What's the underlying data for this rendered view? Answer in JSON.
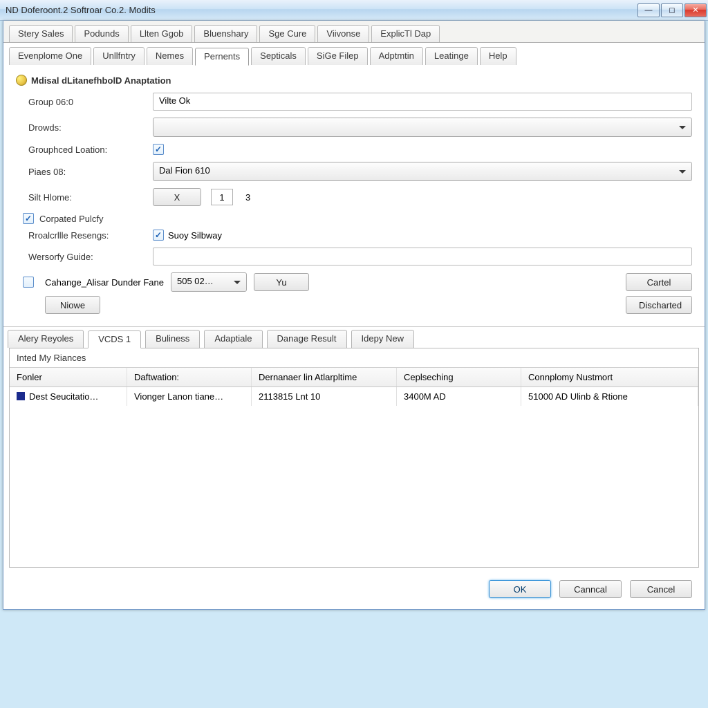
{
  "titlebar": {
    "title": "ND Doferoont.2 Softroar Co.2. Modits"
  },
  "tabs_top": [
    "Stery Sales",
    "Podunds",
    "Llten Ggob",
    "Bluenshary",
    "Sge Cure",
    "Viivonse",
    "ExplicTl Dap"
  ],
  "tabs_main": [
    "Evenplome One",
    "Unllfntry",
    "Nemes",
    "Pernents",
    "Septicals",
    "SiGe Filep",
    "Adptmtin",
    "Leatinge",
    "Help"
  ],
  "tabs_main_active": 3,
  "section": {
    "title": "Mdisal dLitanefhbolD Anaptation",
    "group_label": "Group 06:0",
    "group_value": "Vilte Ok",
    "drowds_label": "Drowds:",
    "drowds_value": "",
    "grouphced_label": "Grouphced Loation:",
    "grouphced_checked": true,
    "piaes_label": "Piaes 08:",
    "piaes_value": "Dal Fion 610",
    "silhome_label": "Silt Hlome:",
    "silhome_x": "X",
    "silhome_1": "1",
    "silhome_3": "3"
  },
  "corpated": {
    "checked": true,
    "label": "Corpated Pulcfy",
    "rroalcr_label": "Rroalcrllle Resengs:",
    "suoy_checked": true,
    "suoy_label": "Suoy Silbway",
    "wersorfy_label": "Wersorfy Guide:",
    "wersorfy_value": ""
  },
  "actions": {
    "cahange_checked": false,
    "cahange_label": "Cahange_Alisar Dunder Fane",
    "cahange_combo": "505 02…",
    "yu": "Yu",
    "niowe": "Niowe",
    "cartel": "Cartel",
    "discharted": "Discharted"
  },
  "subtabs": [
    "Alery Reyoles",
    "VCDS 1",
    "Buliness",
    "Adaptiale",
    "Danage  Result",
    "Idepy  New"
  ],
  "subtabs_active": 1,
  "table": {
    "title": "Inted My Riances",
    "columns": [
      "Fonler",
      "Daftwation:",
      "Dernanaer lin Atlarpltime",
      "Ceplseching",
      "Connplomy Nustmort"
    ],
    "rows": [
      [
        "Dest Seucitatio…",
        "Vionger Lanon tiane…",
        "2113815 Lnt 10",
        "3400M AD",
        "51000 AD Ulinb & Rtione"
      ]
    ]
  },
  "dlg": {
    "ok": "OK",
    "canncal": "Canncal",
    "cancel": "Cancel"
  }
}
